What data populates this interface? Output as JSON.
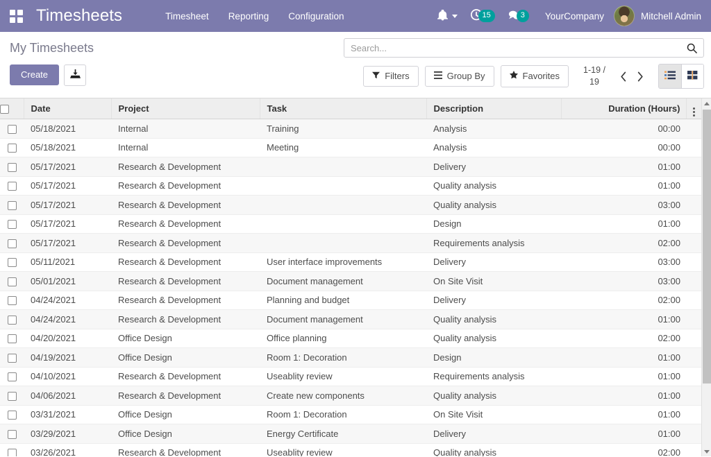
{
  "navbar": {
    "apps_icon": "apps-grid-icon",
    "brand": "Timesheets",
    "menu": [
      {
        "label": "Timesheet"
      },
      {
        "label": "Reporting"
      },
      {
        "label": "Configuration"
      }
    ],
    "bell_icon": "bell-icon",
    "activity_icon": "clock-activity-icon",
    "activity_count": "15",
    "messages_icon": "chat-bubble-icon",
    "messages_count": "3",
    "company": "YourCompany",
    "user": "Mitchell Admin",
    "accent_color": "#7c7bad",
    "badge_color": "#00a09d"
  },
  "control_panel": {
    "breadcrumb": "My Timesheets",
    "create_label": "Create",
    "import_icon": "import-upload-icon",
    "search": {
      "placeholder": "Search...",
      "value": "",
      "icon": "search-icon"
    },
    "filters_label": "Filters",
    "group_by_label": "Group By",
    "favorites_label": "Favorites",
    "pager": "1-19 / 19",
    "prev_icon": "chevron-left-icon",
    "next_icon": "chevron-right-icon",
    "views": [
      {
        "name": "list",
        "icon": "list-view-icon",
        "active": true
      },
      {
        "name": "kanban",
        "icon": "kanban-view-icon",
        "active": false
      }
    ]
  },
  "table": {
    "columns": [
      "Date",
      "Project",
      "Task",
      "Description",
      "Duration (Hours)"
    ],
    "options_icon": "column-options-icon",
    "rows": [
      {
        "date": "05/18/2021",
        "project": "Internal",
        "task": "Training",
        "description": "Analysis",
        "duration": "00:00"
      },
      {
        "date": "05/18/2021",
        "project": "Internal",
        "task": "Meeting",
        "description": "Analysis",
        "duration": "00:00"
      },
      {
        "date": "05/17/2021",
        "project": "Research & Development",
        "task": "",
        "description": "Delivery",
        "duration": "01:00"
      },
      {
        "date": "05/17/2021",
        "project": "Research & Development",
        "task": "",
        "description": "Quality analysis",
        "duration": "01:00"
      },
      {
        "date": "05/17/2021",
        "project": "Research & Development",
        "task": "",
        "description": "Quality analysis",
        "duration": "03:00"
      },
      {
        "date": "05/17/2021",
        "project": "Research & Development",
        "task": "",
        "description": "Design",
        "duration": "01:00"
      },
      {
        "date": "05/17/2021",
        "project": "Research & Development",
        "task": "",
        "description": "Requirements analysis",
        "duration": "02:00"
      },
      {
        "date": "05/11/2021",
        "project": "Research & Development",
        "task": "User interface improvements",
        "description": "Delivery",
        "duration": "03:00"
      },
      {
        "date": "05/01/2021",
        "project": "Research & Development",
        "task": "Document management",
        "description": "On Site Visit",
        "duration": "03:00"
      },
      {
        "date": "04/24/2021",
        "project": "Research & Development",
        "task": "Planning and budget",
        "description": "Delivery",
        "duration": "02:00"
      },
      {
        "date": "04/24/2021",
        "project": "Research & Development",
        "task": "Document management",
        "description": "Quality analysis",
        "duration": "01:00"
      },
      {
        "date": "04/20/2021",
        "project": "Office Design",
        "task": "Office planning",
        "description": "Quality analysis",
        "duration": "02:00"
      },
      {
        "date": "04/19/2021",
        "project": "Office Design",
        "task": "Room 1: Decoration",
        "description": "Design",
        "duration": "01:00"
      },
      {
        "date": "04/10/2021",
        "project": "Research & Development",
        "task": "Useablity review",
        "description": "Requirements analysis",
        "duration": "01:00"
      },
      {
        "date": "04/06/2021",
        "project": "Research & Development",
        "task": "Create new components",
        "description": "Quality analysis",
        "duration": "01:00"
      },
      {
        "date": "03/31/2021",
        "project": "Office Design",
        "task": "Room 1: Decoration",
        "description": "On Site Visit",
        "duration": "01:00"
      },
      {
        "date": "03/29/2021",
        "project": "Office Design",
        "task": "Energy Certificate",
        "description": "Delivery",
        "duration": "01:00"
      },
      {
        "date": "03/26/2021",
        "project": "Research & Development",
        "task": "Useablity review",
        "description": "Quality analysis",
        "duration": "02:00"
      }
    ]
  }
}
